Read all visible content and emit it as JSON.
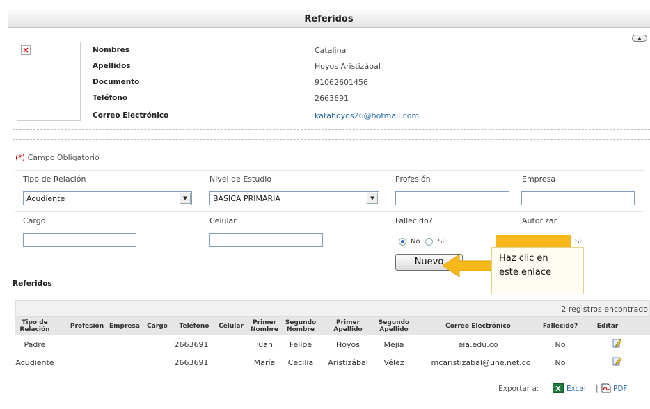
{
  "header": {
    "title": "Referidos"
  },
  "person": {
    "fields": [
      {
        "label": "Nombres",
        "value": "Catalina"
      },
      {
        "label": "Apellidos",
        "value": "Hoyos  Aristizábal"
      },
      {
        "label": "Documento",
        "value": "91062601456"
      },
      {
        "label": "Teléfono",
        "value": "2663691"
      },
      {
        "label": "Correo Electrónico",
        "value": "katahoyos26@hotmail.com"
      }
    ]
  },
  "form": {
    "required_star": "(*)",
    "required_text": " Campo Obligatorio",
    "labels": {
      "tipo_relacion": "Tipo de Relación",
      "nivel_estudio": "Nivel de Estudio",
      "profesion": "Profesión",
      "empresa": "Empresa",
      "cargo": "Cargo",
      "celular": "Celular",
      "fallecido": "Fallecido?",
      "autorizar": "Autorizar"
    },
    "tipo_relacion_value": "Acudiente",
    "nivel_estudio_value": "BASICA PRIMARIA",
    "radio_no": "No",
    "radio_si": "Si",
    "autorizar_si": "Si",
    "nuevo_label": "Nuevo"
  },
  "callout": {
    "line1": "Haz clic  en",
    "line2": "este enlace"
  },
  "section_title": "Referidos",
  "grid": {
    "count_text": "2 registros encontrado",
    "headers": [
      [
        "Tipo de",
        "Relación"
      ],
      [
        "Profesión",
        ""
      ],
      [
        "Empresa",
        ""
      ],
      [
        "Cargo",
        ""
      ],
      [
        "Teléfono",
        ""
      ],
      [
        "Celular",
        ""
      ],
      [
        "Primer",
        "Nombre"
      ],
      [
        "Segundo",
        "Nombre"
      ],
      [
        "Primer",
        "Apellido"
      ],
      [
        "Segundo",
        "Apellido"
      ],
      [
        "Correo Electrónico",
        ""
      ],
      [
        "Fallecido?",
        ""
      ],
      [
        "Editar",
        ""
      ]
    ],
    "rows": [
      [
        "Padre",
        "",
        "",
        "",
        "2663691",
        "",
        "Juan",
        "Felipe",
        "Hoyos",
        "Mejía",
        "eia.edu.co",
        "No"
      ],
      [
        "Acudiente",
        "",
        "",
        "",
        "2663691",
        "",
        "María",
        "Cecilia",
        "Aristizábal",
        "Vélez",
        "mcaristizabal@une.net.co",
        "No"
      ]
    ]
  },
  "export": {
    "label": "Exportar a:",
    "excel": "Excel",
    "separator": "|",
    "pdf": "PDF"
  },
  "colors": {
    "accent": "#2b6cb0",
    "callout": "#f7b81c",
    "required": "#cc0000"
  }
}
